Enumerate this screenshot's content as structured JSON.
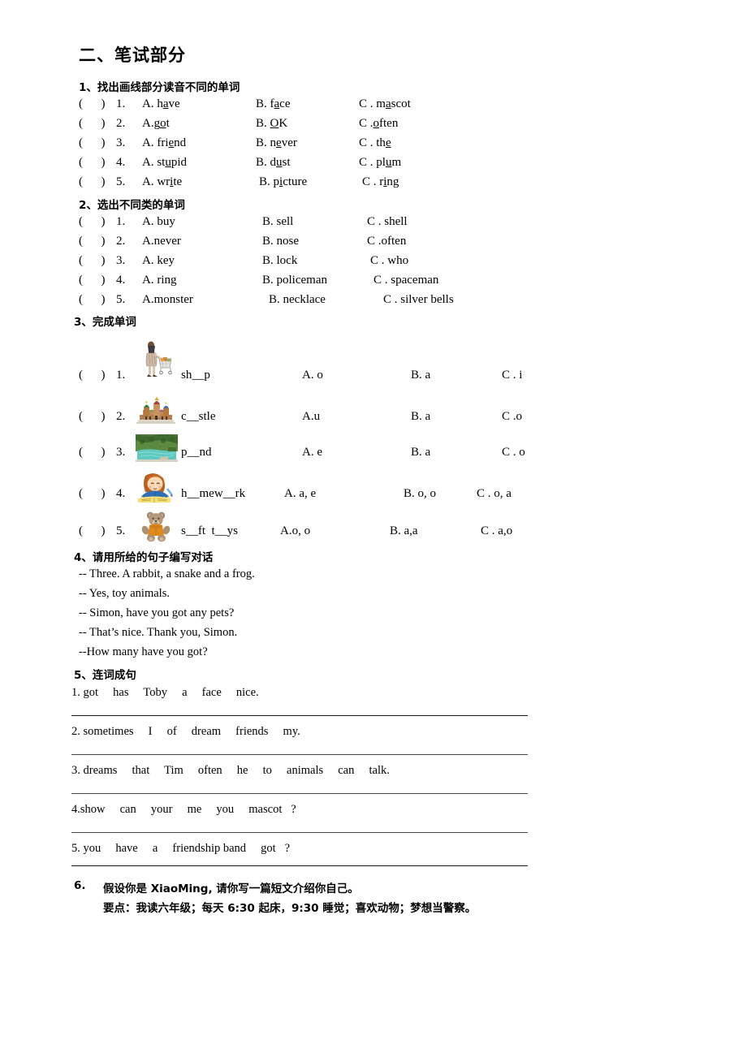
{
  "document": {
    "title": "二、笔试部分"
  },
  "section1": {
    "heading": "1、找出画线部分读音不同的单词",
    "items": [
      {
        "num": "1.",
        "paren": "(      )",
        "a_pre": "A. h",
        "a_u": "a",
        "a_post": "ve",
        "b_pre": "B. f",
        "b_u": "a",
        "b_post": "ce",
        "c_pre": "C . m",
        "c_u": "a",
        "c_post": "scot"
      },
      {
        "num": "2.",
        "paren": "(      )",
        "a_pre": "A.g",
        "a_u": "o",
        "a_post": "t",
        "b_pre": "B. ",
        "b_u": "O",
        "b_post": "K",
        "c_pre": "C .",
        "c_u": "o",
        "c_post": "ften"
      },
      {
        "num": "3.",
        "paren": "(      )",
        "a_pre": "A. fri",
        "a_u": "e",
        "a_post": "nd",
        "b_pre": "B. n",
        "b_u": "e",
        "b_post": "ver",
        "c_pre": "C . th",
        "c_u": "e",
        "c_post": ""
      },
      {
        "num": "4.",
        "paren": "(      )",
        "a_pre": "A. st",
        "a_u": "u",
        "a_post": "pid",
        "b_pre": "B. d",
        "b_u": "u",
        "b_post": "st",
        "c_pre": "C . pl",
        "c_u": "u",
        "c_post": "m"
      },
      {
        "num": "5.",
        "paren": "(      )",
        "a_pre": "A. wr",
        "a_u": "i",
        "a_post": "te",
        "b_pre": "B. p",
        "b_u": "i",
        "b_post": "cture",
        "c_pre": "C . r",
        "c_u": "i",
        "c_post": "ng"
      }
    ]
  },
  "section2": {
    "heading": "2、选出不同类的单词",
    "items": [
      {
        "num": "1.",
        "paren": "(      )",
        "a": "A. buy",
        "b": "B. sell",
        "c": "C . shell"
      },
      {
        "num": "2.",
        "paren": "(      )",
        "a": "A.never",
        "b": "B. nose",
        "c": "C .often"
      },
      {
        "num": "3.",
        "paren": "(      )",
        "a": "A. key",
        "b": "B. lock",
        "c": "C . who"
      },
      {
        "num": "4.",
        "paren": "(      )",
        "a": "A. ring",
        "b": "B. policeman",
        "c": "C . spaceman"
      },
      {
        "num": "5.",
        "paren": "(      )",
        "a": "A.monster",
        "b": "B. necklace",
        "c": "C . silver bells"
      }
    ]
  },
  "section3": {
    "heading": "3、完成单词",
    "items": [
      {
        "num": "1.",
        "paren": "(      )",
        "picture": "woman-shopping-cart-photo",
        "word": "sh__p",
        "a": "A. o",
        "b": "B. a",
        "c": "C . i"
      },
      {
        "num": "2.",
        "paren": "(      )",
        "picture": "castle-photo",
        "word": "c__stle",
        "a": "A.u",
        "b": "B. a",
        "c": "C .o"
      },
      {
        "num": "3.",
        "paren": "(      )",
        "picture": "pond-photo",
        "word": "p__nd",
        "a": "A. e",
        "b": "B. a",
        "c": "C . o"
      },
      {
        "num": "4.",
        "paren": "(      )",
        "picture": "girl-homework-clipart",
        "word": "h__mew__rk",
        "a": "A. a, e",
        "b": "B. o, o",
        "c": "C . o, a"
      },
      {
        "num": "5.",
        "paren": "(      )",
        "picture": "teddy-bear-photo",
        "word": "s__ft  t__ys",
        "a": "A.o, o",
        "b": "B. a,a",
        "c": "C . a,o"
      }
    ]
  },
  "section4": {
    "heading": "4、请用所给的句子编写对话",
    "lines": [
      "-- Three. A rabbit, a snake and a frog.",
      "-- Yes, toy animals.",
      "-- Simon, have you got any pets?",
      "-- That’s nice. Thank you, Simon.",
      "--How many have you got?"
    ]
  },
  "section5": {
    "heading": "5、连词成句",
    "lines": [
      "1. got     has     Toby     a     face     nice.",
      "2. sometimes     I     of     dream     friends     my.",
      "3. dreams     that     Tim     often     he     to     animals     can     talk.",
      "4.show     can     your     me     you     mascot   ?",
      "5. you     have     a     friendship band     got   ?"
    ]
  },
  "section6": {
    "number": "6.",
    "line1": "假设你是 XiaoMing, 请你写一篇短文介绍你自己。",
    "line2": "要点：我读六年级；每天 6:30 起床，9:30 睡觉；喜欢动物；梦想当警察。"
  }
}
